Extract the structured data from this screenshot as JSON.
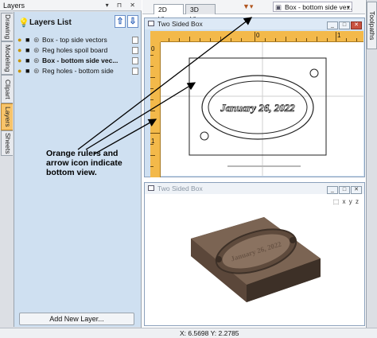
{
  "panel": {
    "title": "Layers",
    "side_tabs": [
      "Drawing",
      "Modeling",
      "Clipart",
      "Layers",
      "Sheets"
    ],
    "active_tab": "Layers",
    "list_title": "Layers List",
    "layers": [
      {
        "label": "Box - top side vectors"
      },
      {
        "label": "Reg holes spoil board"
      },
      {
        "label": "Box - bottom side vec..."
      },
      {
        "label": "Reg holes - bottom side"
      }
    ],
    "add_layer_label": "Add New Layer..."
  },
  "view_tabs": {
    "tab_2d": "2D View",
    "tab_3d": "3D View"
  },
  "sheet_select": {
    "value": "Box - bottom side ve..."
  },
  "right_tab": {
    "label": "Toolpaths"
  },
  "window_2d": {
    "title": "Two Sided Box",
    "ruler_labels": [
      "0",
      "1",
      "0",
      "1"
    ],
    "engraving_text": "January 26, 2022"
  },
  "window_3d": {
    "title": "Two Sided Box",
    "axis_labels": [
      "x",
      "y",
      "z"
    ]
  },
  "status_bar": {
    "coords": "X: 6.5698 Y: 2.2785"
  },
  "annotation": {
    "text": "Orange rulers and arrow icon indicate bottom view."
  },
  "colors": {
    "ruler": "#f3b94a",
    "panel": "#cfe0f1",
    "wood": "#6b5443"
  }
}
